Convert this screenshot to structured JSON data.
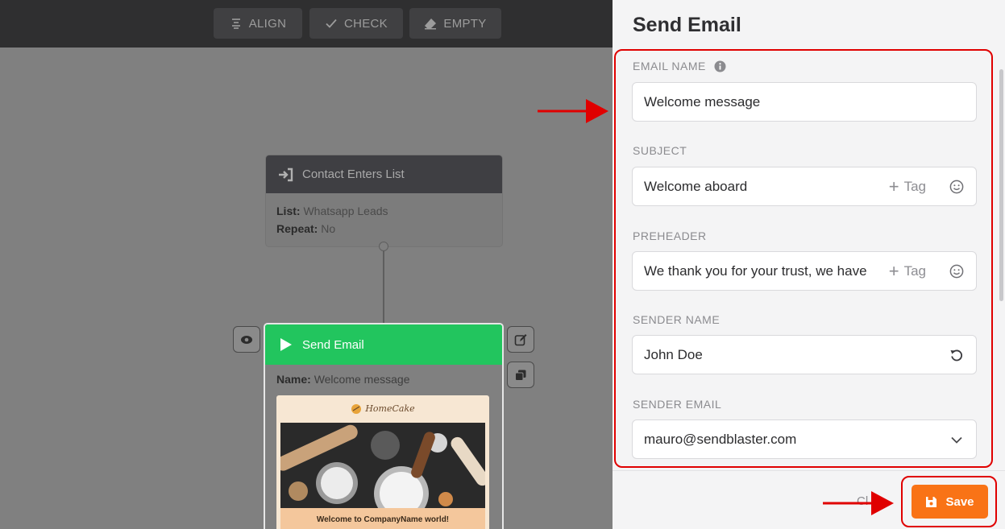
{
  "toolbar": {
    "align_label": "ALIGN",
    "check_label": "CHECK",
    "empty_label": "EMPTY"
  },
  "trigger_node": {
    "title": "Contact Enters List",
    "list_label": "List:",
    "list_value": "Whatsapp Leads",
    "repeat_label": "Repeat:",
    "repeat_value": "No"
  },
  "email_node": {
    "title": "Send Email",
    "name_label": "Name:",
    "name_value": "Welcome message",
    "preview_logo": "HomeCake",
    "preview_footer": "Welcome to CompanyName world!"
  },
  "panel": {
    "title": "Send Email",
    "email_name": {
      "label": "EMAIL NAME",
      "value": "Welcome message"
    },
    "subject": {
      "label": "SUBJECT",
      "value": "Welcome aboard",
      "tag_label": "Tag"
    },
    "preheader": {
      "label": "PREHEADER",
      "value": "We thank you for your trust, we have",
      "tag_label": "Tag"
    },
    "sender_name": {
      "label": "SENDER NAME",
      "value": "John Doe"
    },
    "sender_email": {
      "label": "SENDER EMAIL",
      "value": "mauro@sendblaster.com"
    },
    "close_label": "Cl",
    "save_label": "Save"
  },
  "colors": {
    "accent_green": "#22c55e",
    "save_orange": "#f97316",
    "highlight_red": "#e00000"
  },
  "icons": [
    "align-icon",
    "check-icon",
    "eraser-icon",
    "login-icon",
    "play-icon",
    "eye-icon",
    "edit-icon",
    "copy-icon",
    "info-icon",
    "plus-icon",
    "smiley-icon",
    "reset-icon",
    "chevron-down-icon",
    "floppy-icon",
    "arrow-icon"
  ]
}
